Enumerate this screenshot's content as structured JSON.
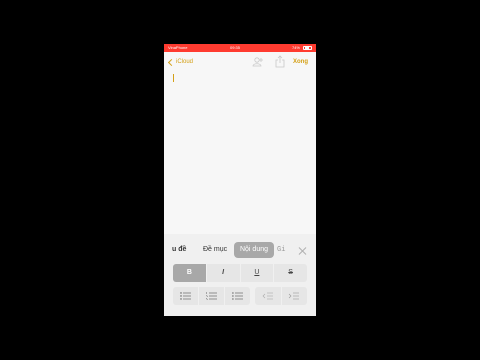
{
  "status_bar": {
    "carrier": "VinaPhone",
    "time": "09:35",
    "battery": "74%"
  },
  "nav": {
    "back_label": "iCloud",
    "done_label": "Xong"
  },
  "format_panel": {
    "styles": [
      "u đề",
      "Đề mục",
      "Nội dung",
      "Gi"
    ],
    "selected_style": "Nội dung",
    "text_buttons": [
      "B",
      "I",
      "U",
      "S"
    ],
    "active_text_button": "B"
  },
  "colors": {
    "status_bar": "#ff3b30",
    "accent": "#d4a017",
    "selected_segment": "#a8a8a8",
    "button_bg": "#e6e6e6",
    "background": "#000000"
  },
  "icons": {
    "back": "chevron-left-icon",
    "share_people": "add-people-icon",
    "share": "share-icon",
    "close": "close-icon",
    "bulleted_list": "bulleted-list-icon",
    "dashed_list": "dashed-list-icon",
    "numbered_list": "numbered-list-icon",
    "outdent": "outdent-icon",
    "indent": "indent-icon"
  }
}
